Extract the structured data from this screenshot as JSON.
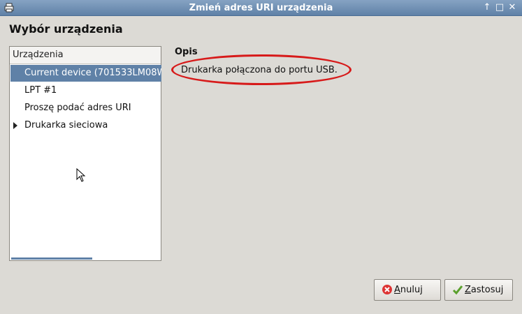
{
  "window": {
    "title": "Zmień adres URI urządzenia"
  },
  "heading": "Wybór urządzenia",
  "device_list": {
    "header": "Urządzenia",
    "items": [
      {
        "label": "Current device (701533LM08W",
        "selected": true,
        "expandable": false
      },
      {
        "label": "LPT #1",
        "selected": false,
        "expandable": false
      },
      {
        "label": "Proszę podać adres URI",
        "selected": false,
        "expandable": false
      },
      {
        "label": "Drukarka sieciowa",
        "selected": false,
        "expandable": true
      }
    ]
  },
  "description": {
    "label": "Opis",
    "text": "Drukarka połączona do portu USB."
  },
  "buttons": {
    "cancel": {
      "mnemonic": "A",
      "rest": "nuluj"
    },
    "apply": {
      "mnemonic": "Z",
      "rest": "astosuj"
    }
  },
  "colors": {
    "annotation": "#d71a1a",
    "selection": "#5f81a7"
  }
}
